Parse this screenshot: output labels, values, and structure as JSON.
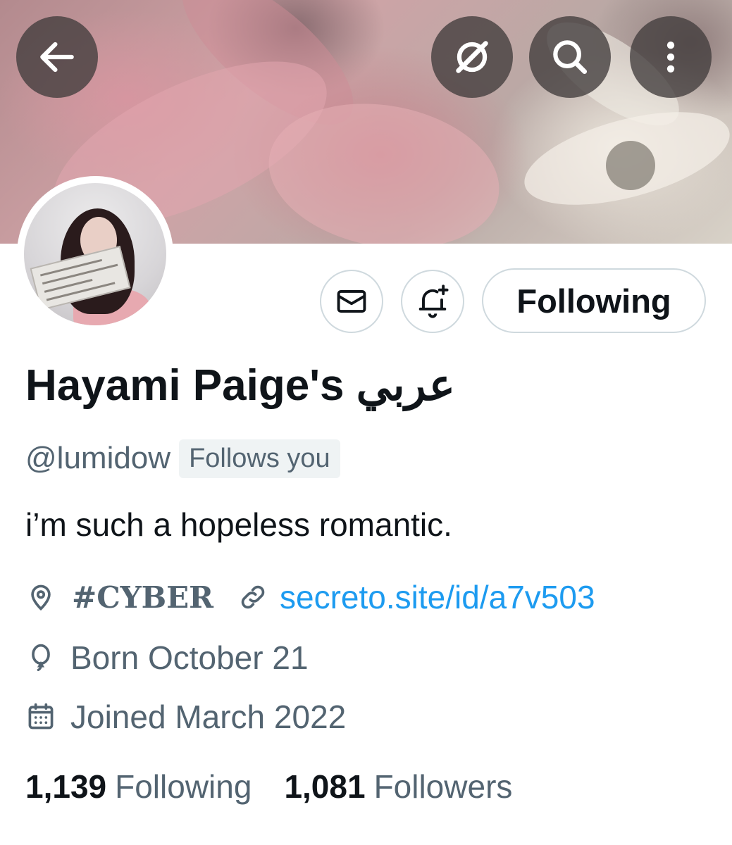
{
  "header": {
    "back_icon": "arrow-left-icon",
    "grok_icon": "grok-icon",
    "search_icon": "search-icon",
    "more_icon": "more-vertical-icon"
  },
  "actions": {
    "message_icon": "mail-icon",
    "notify_icon": "bell-plus-icon",
    "follow_label": "Following"
  },
  "profile": {
    "display_name": "Hayami Paige's عربي",
    "handle": "@lumidow",
    "follows_you": "Follows you",
    "bio": "i’m such a hopeless romantic.",
    "location": "#CYBER",
    "link": "secreto.site/id/a7v503",
    "birthday": "Born October 21",
    "joined": "Joined March 2022"
  },
  "stats": {
    "following_count": "1,139",
    "following_label": "Following",
    "followers_count": "1,081",
    "followers_label": "Followers"
  },
  "colors": {
    "link": "#1d9bf0",
    "secondary_text": "#536471",
    "primary_text": "#0f1419",
    "border": "#cfd9de"
  }
}
